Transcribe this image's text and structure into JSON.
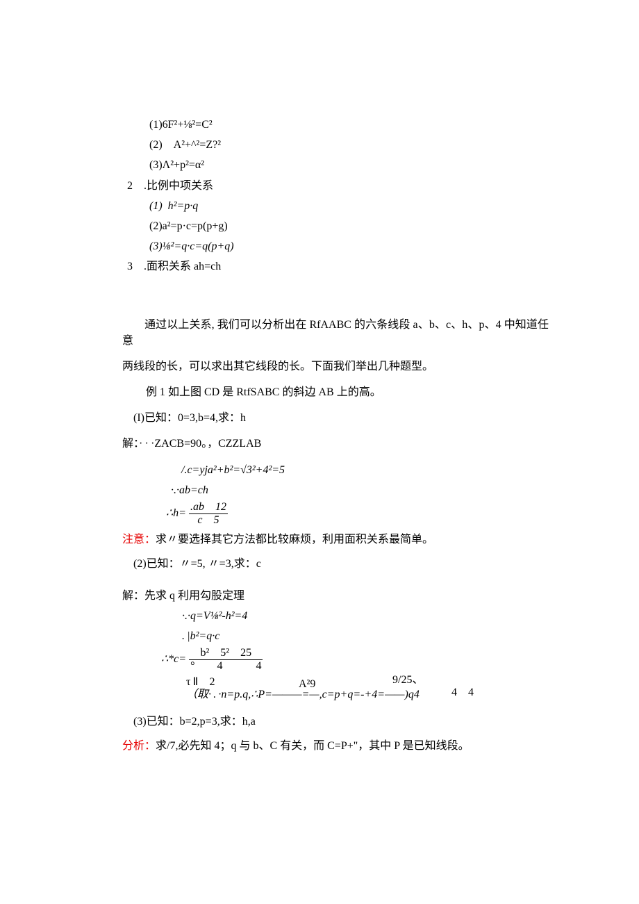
{
  "block1": {
    "l1": "(1)6F²+⅛²=C²",
    "l2": "(2) A²+^²=Z?²",
    "l3": "(3)Λ²+p²=α²",
    "l4": "2 .比例中项关系",
    "l5": "(1) h²=p·q",
    "l6": "(2)a²=p·c=p(p+g)",
    "l7": "(3)⅛²=q·c=q(p+q)",
    "l8": "3 .面积关系 ah=ch"
  },
  "para": {
    "indent": "通过以上关系, 我们可以分析出在 RfAABC 的六条线段 a、b、c、h、p、4 中知道任意",
    "cont": "两线段的长，可以求出其它线段的长。下面我们举出几种题型。",
    "ex1": "例 1 如上图 CD 是 RtfSABC 的斜边 AB 上的高。"
  },
  "ex": {
    "ex1_1": "(I)已知：0=3,b=4,求：h",
    "sol1_head": "解：· · ·ZACB=90。，CZZLAB",
    "sol1_line1": "/.c=yja²+b²=√3²+4²=5",
    "sol1_line2": "·.·ab=ch",
    "sol1_h_lead": "∴h=",
    "sol1_h_num": ".ab 12",
    "sol1_h_den": "c 5",
    "sol1_h_mid": "=",
    "note1_red": "注意：",
    "note1": "求〃要选择其它方法都比较麻烦，利用面积关系最简单。",
    "ex1_2": "(2)已知：〃=5, 〃=3,求：c",
    "sol2_head": "解：先求 q 利用勾股定理",
    "sol2_line1": "·.·q=V⅛²-h²=4",
    "sol2_line2": ". |b²=q·c",
    "sol2_c_lead": "∴*c=",
    "sol2_c_num": "b² 5² 25",
    "sol2_c_den": "°  4   4",
    "sol2_c_mid": "=",
    "sol2_line3_a": "τ Ⅱ 2",
    "sol2_line3_b": "（取· . ·n=p.q,∴P=———=—,c=p+q=-+4=——)q4",
    "sol2_line3_c": "A²9",
    "sol2_line3_d": "9/25、",
    "sol2_line3_e": "4 4",
    "ex1_3": "(3)已知：b=2,p=3,求：h,a",
    "analysis_red": "分析：",
    "analysis": "求/7,必先知 4；q 与 b、C 有关，而 C=P+\"，其中 P 是已知线段。"
  }
}
